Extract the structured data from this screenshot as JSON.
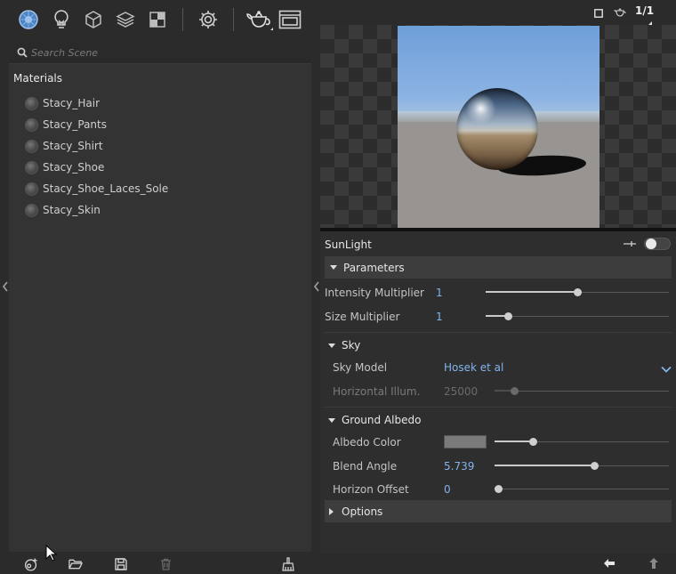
{
  "toolbar": {
    "icons": [
      "material-ball-icon",
      "light-bulb-icon",
      "cube-icon",
      "layers-icon",
      "texture-checker-icon",
      "gear-icon",
      "teapot-icon",
      "window-icon"
    ]
  },
  "search": {
    "placeholder": "Search Scene",
    "value": ""
  },
  "materials": {
    "header": "Materials",
    "items": [
      {
        "label": "Stacy_Hair"
      },
      {
        "label": "Stacy_Pants"
      },
      {
        "label": "Stacy_Shirt"
      },
      {
        "label": "Stacy_Shoe"
      },
      {
        "label": "Stacy_Shoe_Laces_Sole"
      },
      {
        "label": "Stacy_Skin"
      }
    ]
  },
  "viewport": {
    "page_counter": "1/1"
  },
  "sunlight": {
    "title": "SunLight",
    "enabled": false,
    "parameters_section": "Parameters",
    "intensity_label": "Intensity Multiplier",
    "intensity_value": "1",
    "intensity_slider": 0.5,
    "size_label": "Size Multiplier",
    "size_value": "1",
    "size_slider": 0.12,
    "sky_section": "Sky",
    "sky_model_label": "Sky Model",
    "sky_model_value": "Hosek et al",
    "horizontal_illum_label": "Horizontal Illum.",
    "horizontal_illum_value": "25000",
    "horizontal_illum_slider": 0.11,
    "ground_section": "Ground Albedo",
    "albedo_color_label": "Albedo Color",
    "albedo_color_hex": "#7a7a7a",
    "albedo_slider": 0.22,
    "blend_angle_label": "Blend Angle",
    "blend_angle_value": "5.739",
    "blend_angle_slider": 0.57,
    "horizon_offset_label": "Horizon Offset",
    "horizon_offset_value": "0",
    "horizon_offset_slider": 0.02,
    "options_section": "Options"
  },
  "colors": {
    "accent_blue": "#82b4ec",
    "panel_bg": "#2b2b2b",
    "list_bg": "#333333"
  }
}
